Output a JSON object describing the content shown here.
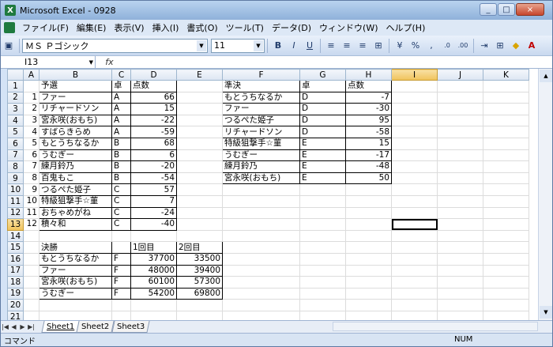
{
  "window": {
    "title": "Microsoft Excel - 0928",
    "min": "_",
    "max": "□",
    "close": "×",
    "app_icon": "excel-icon"
  },
  "menu": [
    "ファイル(F)",
    "編集(E)",
    "表示(V)",
    "挿入(I)",
    "書式(O)",
    "ツール(T)",
    "データ(D)",
    "ウィンドウ(W)",
    "ヘルプ(H)"
  ],
  "toolbar": {
    "font_name": "ＭＳ Ｐゴシック",
    "font_size": "11",
    "bold": "B",
    "italic": "I",
    "underline": "U",
    "percent": "%",
    "comma": ",",
    "inc_dec": ".0",
    "dec_dec": ".00"
  },
  "formula_bar": {
    "name_box": "I13",
    "fx": "fx",
    "content": ""
  },
  "columns": [
    "A",
    "B",
    "C",
    "D",
    "E",
    "F",
    "G",
    "H",
    "I",
    "J",
    "K"
  ],
  "active_cell": {
    "col": "I",
    "row": 13
  },
  "cells": {
    "B1": "予選",
    "C1": "卓",
    "D1": "点数",
    "F1": "準決",
    "G1": "卓",
    "H1": "点数",
    "A2": "1",
    "B2": "ファー",
    "C2": "A",
    "D2": "66",
    "F2": "もとうちなるか",
    "G2": "D",
    "H2": "-7",
    "A3": "2",
    "B3": "リチャードソン",
    "C3": "A",
    "D3": "15",
    "F3": "ファー",
    "G3": "D",
    "H3": "-30",
    "A4": "3",
    "B4": "宮永咲(おもち)",
    "C4": "A",
    "D4": "-22",
    "F4": "つるぺた姫子",
    "G4": "D",
    "H4": "95",
    "A5": "4",
    "B5": "すばらきらめ",
    "C5": "A",
    "D5": "-59",
    "F5": "リチャードソン",
    "G5": "D",
    "H5": "-58",
    "A6": "5",
    "B6": "もとうちなるか",
    "C6": "B",
    "D6": "68",
    "F6": "特級狙撃手☆菫",
    "G6": "E",
    "H6": "15",
    "A7": "6",
    "B7": "うむぎー",
    "C7": "B",
    "D7": "6",
    "F7": "うむぎー",
    "G7": "E",
    "H7": "-17",
    "A8": "7",
    "B8": "練月鈴乃",
    "C8": "B",
    "D8": "-20",
    "F8": "練月鈴乃",
    "G8": "E",
    "H8": "-48",
    "A9": "8",
    "B9": "百鬼もこ",
    "C9": "B",
    "D9": "-54",
    "F9": "宮永咲(おもち)",
    "G9": "E",
    "H9": "50",
    "A10": "9",
    "B10": "つるぺた姫子",
    "C10": "C",
    "D10": "57",
    "A11": "10",
    "B11": "特級狙撃手☆菫",
    "C11": "C",
    "D11": "7",
    "A12": "11",
    "B12": "おちゃめがね",
    "C12": "C",
    "D12": "-24",
    "A13": "12",
    "B13": "積々和",
    "C13": "C",
    "D13": "-40",
    "B15": "決勝",
    "D15": "1回目",
    "E15": "2回目",
    "B16": "もとうちなるか",
    "C16": "F",
    "D16": "37700",
    "E16": "33500",
    "B17": "ファー",
    "C17": "F",
    "D17": "48000",
    "E17": "39400",
    "B18": "宮永咲(おもち)",
    "C18": "F",
    "D18": "60100",
    "E18": "57300",
    "B19": "うむぎー",
    "C19": "F",
    "D19": "54200",
    "E19": "69800"
  },
  "sheets": [
    "Sheet1",
    "Sheet2",
    "Sheet3"
  ],
  "status": {
    "left": "コマンド",
    "num": "NUM"
  }
}
